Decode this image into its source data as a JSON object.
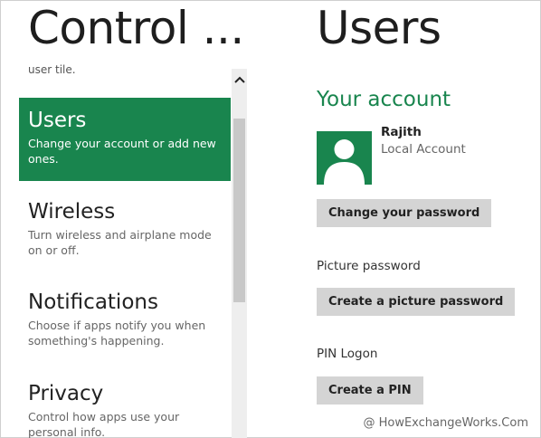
{
  "left_pane": {
    "title": "Control ...",
    "cut_text": "user tile.",
    "items": [
      {
        "name": "Users",
        "desc": "Change your account or add new ones.",
        "selected": true
      },
      {
        "name": "Wireless",
        "desc": "Turn wireless and airplane mode on or off."
      },
      {
        "name": "Notifications",
        "desc": "Choose if apps notify you when something's happening."
      },
      {
        "name": "Privacy",
        "desc": "Control how apps use your personal info."
      }
    ]
  },
  "scrollbar": {
    "up_icon": "chevron-up-icon"
  },
  "right_pane": {
    "title": "Users",
    "account_heading": "Your account",
    "user_name": "Rajith",
    "account_type": "Local Account",
    "change_password_button": "Change your password",
    "picture_password_label": "Picture password",
    "create_picture_password_button": "Create a picture password",
    "pin_label": "PIN Logon",
    "create_pin_button": "Create a PIN"
  },
  "watermark": "@ HowExchangeWorks.Com",
  "colors": {
    "accent": "#19854e",
    "button": "#d4d4d4",
    "scroll_track": "#eeeeee"
  }
}
